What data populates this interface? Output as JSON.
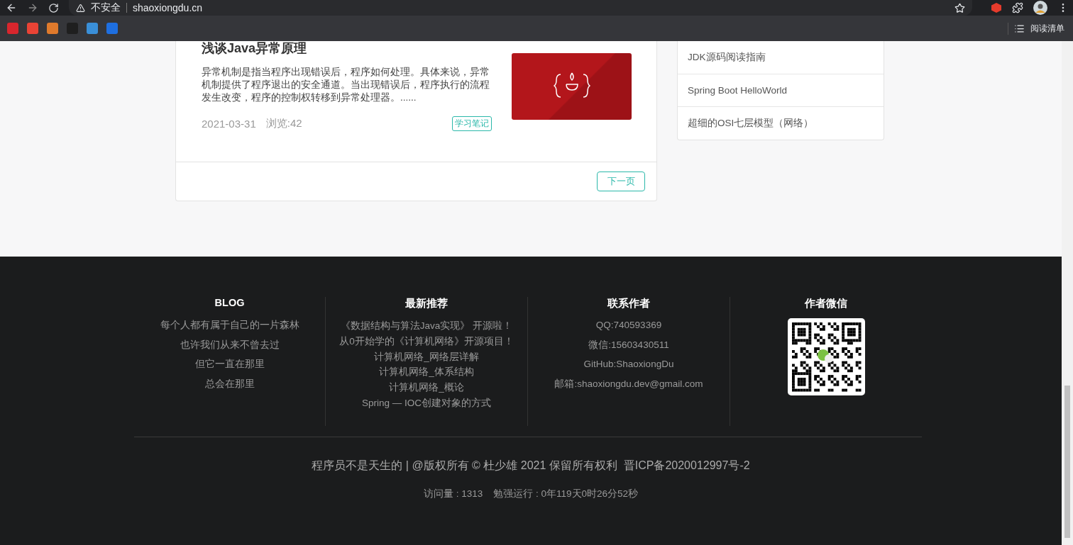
{
  "browser": {
    "security_label": "不安全",
    "url": "shaoxiongdu.cn",
    "reading_list": "阅读清单"
  },
  "article": {
    "title": "浅谈Java异常原理",
    "excerpt": "异常机制是指当程序出现错误后，程序如何处理。具体来说，异常机制提供了程序退出的安全通道。当出现错误后，程序执行的流程发生改变，程序的控制权转移到异常处理器。......",
    "date": "2021-03-31",
    "views": "浏览:42",
    "tag": "学习笔记"
  },
  "pagination": {
    "next": "下一页"
  },
  "sidebar": {
    "items": [
      "JDK源码阅读指南",
      "Spring Boot HelloWorld",
      "超细的OSI七层模型（网络）"
    ]
  },
  "footer": {
    "columns": [
      {
        "kind": "links",
        "title": "BLOG",
        "items": [
          "每个人都有属于自己的一片森林",
          "也许我们从来不曾去过",
          "但它一直在那里",
          "总会在那里"
        ]
      },
      {
        "kind": "dense",
        "title": "最新推荐",
        "items": [
          "《数据结构与算法Java实现》 开源啦！",
          "从0开始学的《计算机网络》开源项目！",
          "计算机网络_网络层详解",
          "计算机网络_体系结构",
          "计算机网络_概论",
          "Spring — IOC创建对象的方式"
        ]
      },
      {
        "kind": "links",
        "title": "联系作者",
        "items": [
          "QQ:740593369",
          "微信:15603430511",
          "GitHub:ShaoxiongDu",
          "邮箱:shaoxiongdu.dev@gmail.com"
        ]
      },
      {
        "kind": "qr",
        "title": "作者微信"
      }
    ],
    "copyright": "程序员不是天生的 | @版权所有 © 杜少雄 2021 保留所有权利  晋ICP备2020012997号-2",
    "stats": "访问量 : 1313    勉强运行 : 0年119天0时26分52秒"
  }
}
